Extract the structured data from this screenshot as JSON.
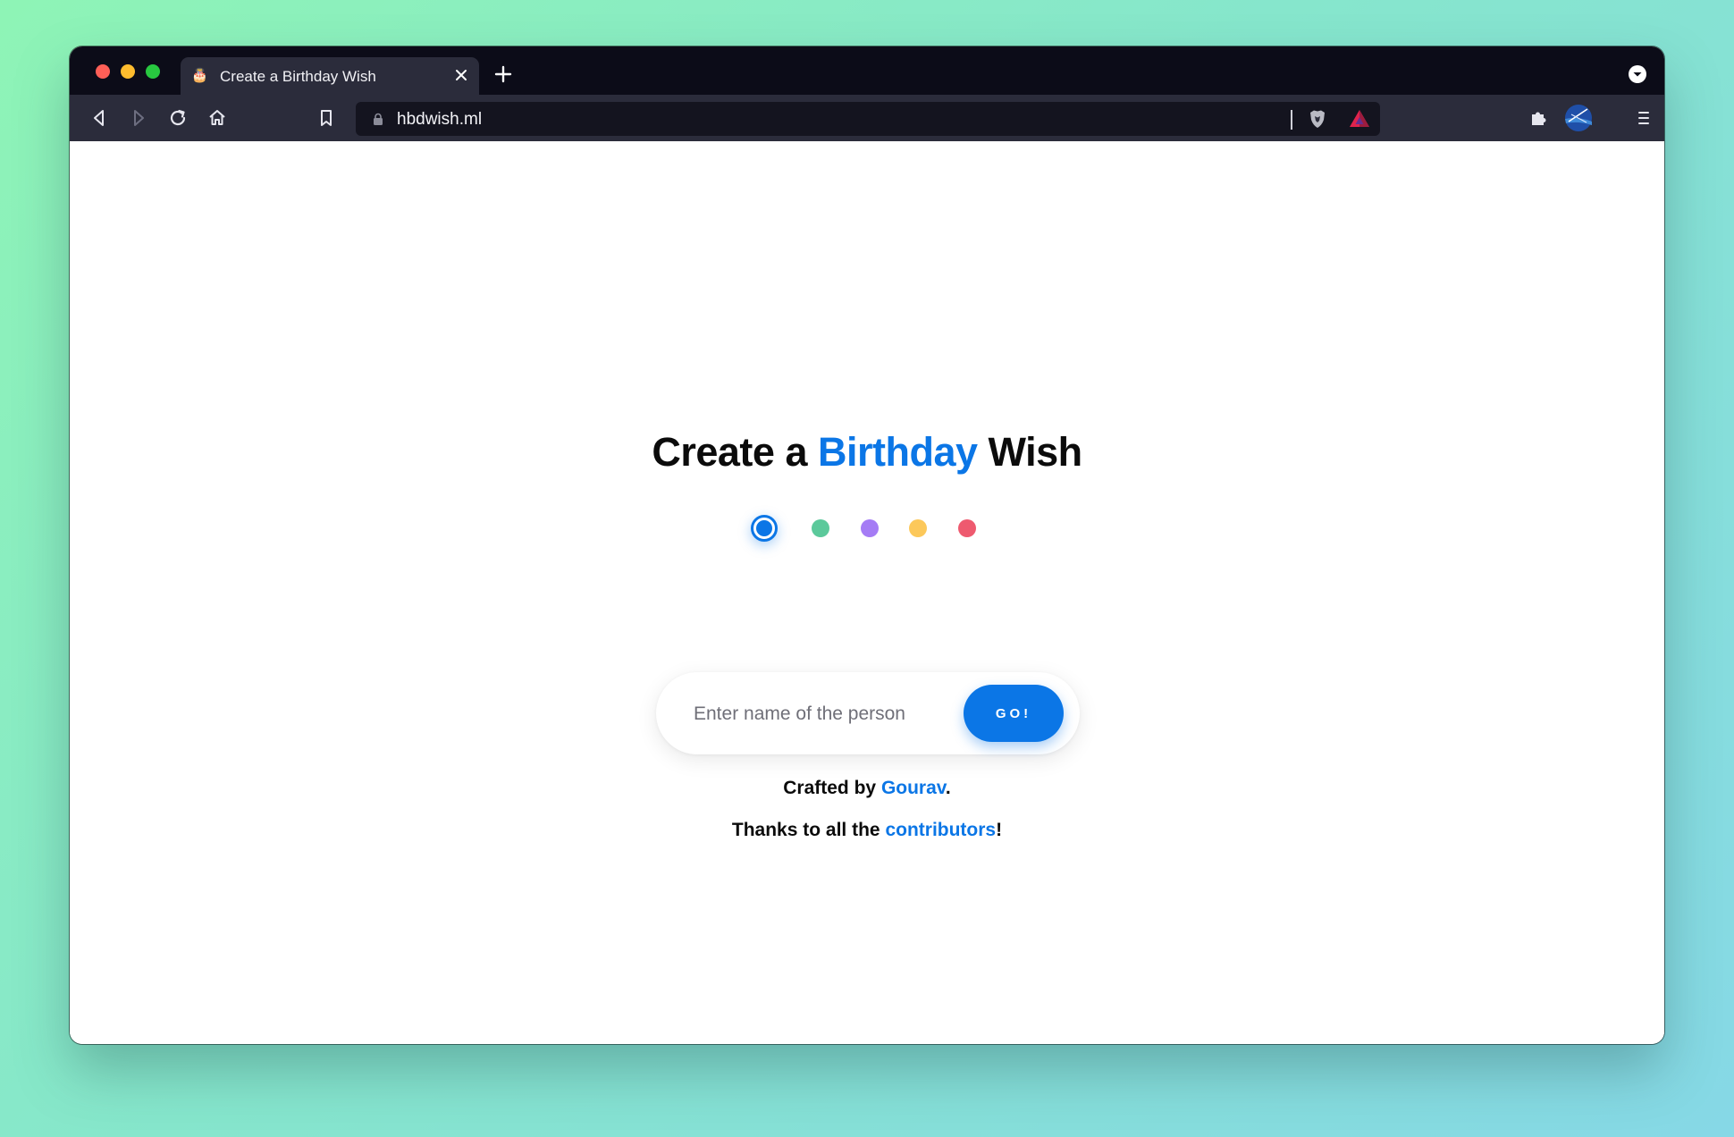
{
  "browser": {
    "tab": {
      "title": "Create a Birthday Wish",
      "favicon": "🎂"
    },
    "url": "hbdwish.ml",
    "icons": {
      "back": "back-arrow-icon",
      "forward": "forward-arrow-icon",
      "reload": "reload-icon",
      "home": "home-icon",
      "bookmark": "bookmark-icon",
      "lock": "lock-icon",
      "brave": "brave-shield-icon",
      "rewards": "brave-rewards-icon",
      "extensions": "puzzle-icon",
      "profile": "profile-avatar-icon",
      "menu": "hamburger-menu-icon"
    }
  },
  "page": {
    "heading": {
      "part1": "Create a",
      "accent": "Birthday",
      "part2": "Wish"
    },
    "color_options": [
      {
        "name": "blue",
        "color": "#0b76e6",
        "selected": true
      },
      {
        "name": "green",
        "color": "#5bc99b",
        "selected": false
      },
      {
        "name": "purple",
        "color": "#a57cf5",
        "selected": false
      },
      {
        "name": "yellow",
        "color": "#fcc85a",
        "selected": false
      },
      {
        "name": "red",
        "color": "#ee5a6f",
        "selected": false
      }
    ],
    "form": {
      "placeholder": "Enter name of the person",
      "value": "",
      "button_label": "GO!"
    },
    "credits": {
      "line1_prefix": "Crafted by",
      "line1_link": "Gourav",
      "line1_suffix": ".",
      "line2_prefix": "Thanks to all the",
      "line2_link": "contributors",
      "line2_suffix": "!"
    }
  },
  "colors": {
    "accent": "#0b76e6",
    "tabbar": "#0c0c18",
    "toolbar": "#2b2c3b"
  }
}
